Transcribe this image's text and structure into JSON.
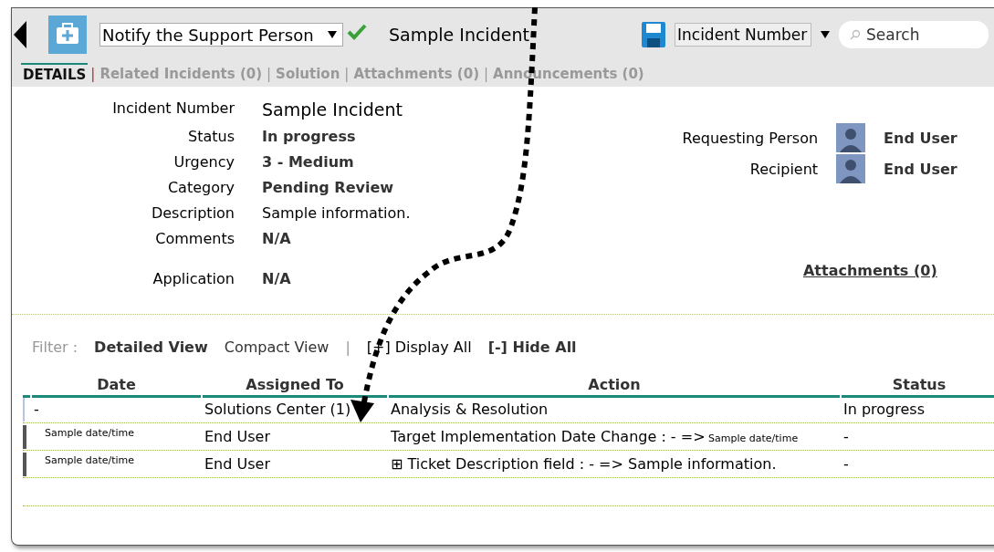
{
  "toolbar": {
    "action_select": "Notify the Support Person",
    "title": "Sample Incident",
    "search_field_select": "Incident Number",
    "search": {
      "placeholder": "Search"
    }
  },
  "tabs": [
    {
      "label": "DETAILS",
      "selected": true
    },
    {
      "separator": "|",
      "label": "Related Incidents (0)",
      "selected": false
    },
    {
      "separator": "|",
      "label": "Solution",
      "selected": false
    },
    {
      "separator": "|",
      "label": "Attachments (0)",
      "selected": false
    },
    {
      "separator": "|",
      "label": "Announcements (0)",
      "selected": false
    }
  ],
  "details": {
    "left": [
      {
        "label": "Incident Number",
        "value": "Sample Incident",
        "kind": "title"
      },
      {
        "label": "Status",
        "value": "In progress",
        "kind": "bold"
      },
      {
        "label": "Urgency",
        "value": "3 - Medium",
        "kind": "bold"
      },
      {
        "label": "Category",
        "value": "Pending Review",
        "kind": "bold"
      },
      {
        "label": "Description",
        "value": "Sample information.",
        "kind": "plain"
      },
      {
        "label": "Comments",
        "value": "N/A",
        "kind": "bold"
      },
      {
        "label": "Application",
        "value": "N/A",
        "kind": "bold"
      }
    ],
    "right": [
      {
        "label": "Requesting Person",
        "value": "End User"
      },
      {
        "label": "Recipient",
        "value": "End User"
      }
    ],
    "attachments_link": "Attachments (0)"
  },
  "filter": {
    "label": "Filter :",
    "views": [
      {
        "label": "Detailed View",
        "selected": true
      },
      {
        "label": "Compact View",
        "selected": false
      }
    ],
    "separator": "|",
    "display_all": "[+] Display All",
    "hide_all": "[-] Hide All"
  },
  "table": {
    "columns": [
      "Date",
      "Assigned To",
      "Action",
      "Status"
    ],
    "rows": [
      {
        "kind": "current",
        "date": "-",
        "assigned_to": "Solutions Center (1)",
        "action": "Analysis & Resolution",
        "status": "In progress"
      },
      {
        "kind": "history",
        "date": "Sample date/time",
        "assigned_to": "End User",
        "action": "Target Implementation Date Change : - =>",
        "action_note": "Sample date/time",
        "status": "-"
      },
      {
        "kind": "history",
        "date": "Sample date/time",
        "assigned_to": "End User",
        "action": "⊞ Ticket Description field : - => Sample information.",
        "status": "-"
      }
    ]
  }
}
